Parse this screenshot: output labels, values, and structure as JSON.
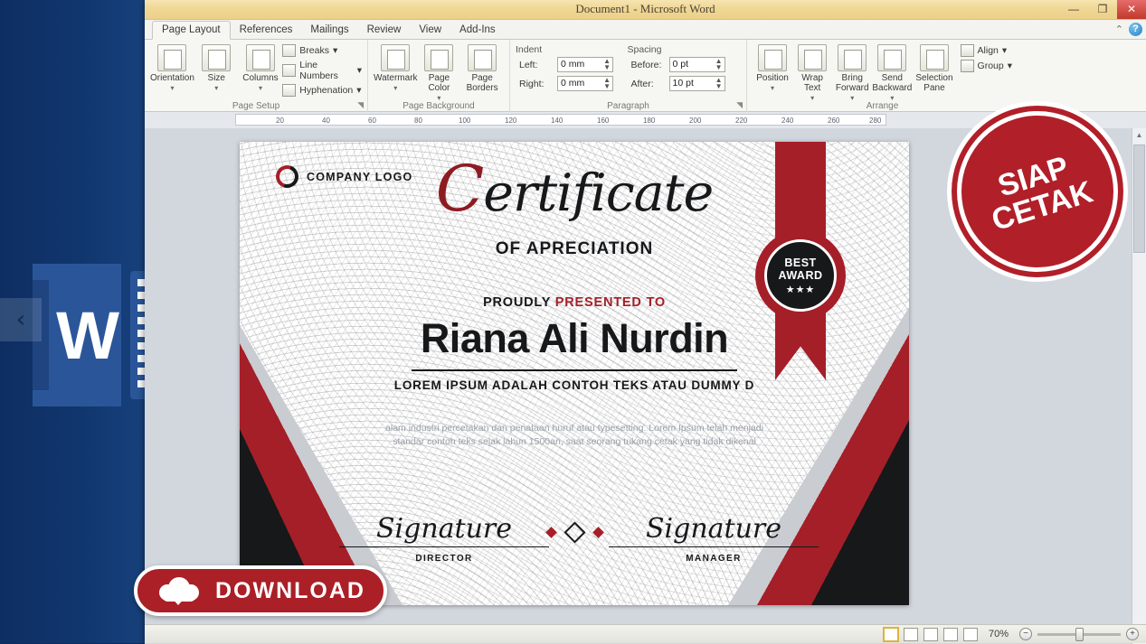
{
  "window": {
    "title": "Document1  -  Microsoft Word",
    "controls": {
      "minimize": "—",
      "restore": "❐",
      "close": "✕"
    },
    "ribbon_collapse": "⌃",
    "help": "?"
  },
  "tabs": [
    {
      "label": "Page Layout",
      "active": true
    },
    {
      "label": "References",
      "active": false
    },
    {
      "label": "Mailings",
      "active": false
    },
    {
      "label": "Review",
      "active": false
    },
    {
      "label": "View",
      "active": false
    },
    {
      "label": "Add-Ins",
      "active": false
    }
  ],
  "ribbon": {
    "groups": [
      {
        "name": "Page Setup",
        "label": "Page Setup",
        "big_buttons": [
          {
            "label": "Orientation",
            "caret": "▾"
          },
          {
            "label": "Size",
            "caret": "▾"
          },
          {
            "label": "Columns",
            "caret": "▾"
          }
        ],
        "small_buttons": [
          {
            "label": "Breaks",
            "caret": "▾"
          },
          {
            "label": "Line Numbers",
            "caret": "▾"
          },
          {
            "label": "Hyphenation",
            "caret": "▾"
          }
        ],
        "dialog_launcher": "◥"
      },
      {
        "name": "Page Background",
        "label": "Page Background",
        "big_buttons": [
          {
            "label": "Watermark",
            "caret": "▾"
          },
          {
            "label": "Page Color",
            "caret": "▾"
          },
          {
            "label": "Page Borders",
            "caret": ""
          }
        ]
      },
      {
        "name": "Paragraph",
        "label": "Paragraph",
        "indent_header": "Indent",
        "spacing_header": "Spacing",
        "fields": [
          {
            "label": "Left:",
            "value": "0 mm"
          },
          {
            "label": "Right:",
            "value": "0 mm"
          },
          {
            "label": "Before:",
            "value": "0 pt"
          },
          {
            "label": "After:",
            "value": "10 pt"
          }
        ],
        "dialog_launcher": "◥"
      },
      {
        "name": "Arrange",
        "label": "Arrange",
        "big_buttons": [
          {
            "label": "Position",
            "caret": "▾"
          },
          {
            "label": "Wrap Text",
            "caret": "▾"
          },
          {
            "label": "Bring Forward",
            "caret": "▾"
          },
          {
            "label": "Send Backward",
            "caret": "▾"
          },
          {
            "label": "Selection Pane",
            "caret": ""
          }
        ],
        "small_buttons": [
          {
            "label": "Align",
            "caret": "▾"
          },
          {
            "label": "Group",
            "caret": "▾"
          }
        ]
      }
    ]
  },
  "ruler": {
    "ticks": [
      "20",
      "40",
      "60",
      "80",
      "100",
      "120",
      "140",
      "160",
      "180",
      "200",
      "220",
      "240",
      "260",
      "280"
    ],
    "unit": "mm"
  },
  "certificate": {
    "company_logo_text": "COMPANY LOGO",
    "title_capital": "C",
    "title_rest": "ertificate",
    "subtitle": "OF APRECIATION",
    "presented_prefix": "PROUDLY ",
    "presented_highlight": "PRESENTED TO",
    "recipient": "Riana Ali Nurdin",
    "tagline": "LOREM IPSUM ADALAH CONTOH TEKS ATAU DUMMY D",
    "body": "alam industri percetakan dan penataan huruf atau typesetting. Lorem Ipsum telah menjadi standar contoh teks sejak lahun 1500an, saat seorang tukang cetak yang tidak dikenal",
    "badge": {
      "line1": "BEST",
      "line2": "AWARD",
      "stars": "★★★"
    },
    "signatures": [
      {
        "script": "Signature",
        "role": "DIRECTOR"
      },
      {
        "script": "Signature",
        "role": "MANAGER"
      }
    ],
    "accent_red": "#a51f28",
    "accent_black": "#17181a"
  },
  "statusbar": {
    "views": [
      "print-layout",
      "full-screen-reading",
      "web-layout",
      "outline",
      "draft"
    ],
    "zoom_level": "70%",
    "zoom_out": "−",
    "zoom_in": "+"
  },
  "overlays": {
    "siap_cetak_line1": "SIAP",
    "siap_cetak_line2": "CETAK",
    "download_label": "DOWNLOAD",
    "nav_left": "‹",
    "nav_right": "›"
  }
}
